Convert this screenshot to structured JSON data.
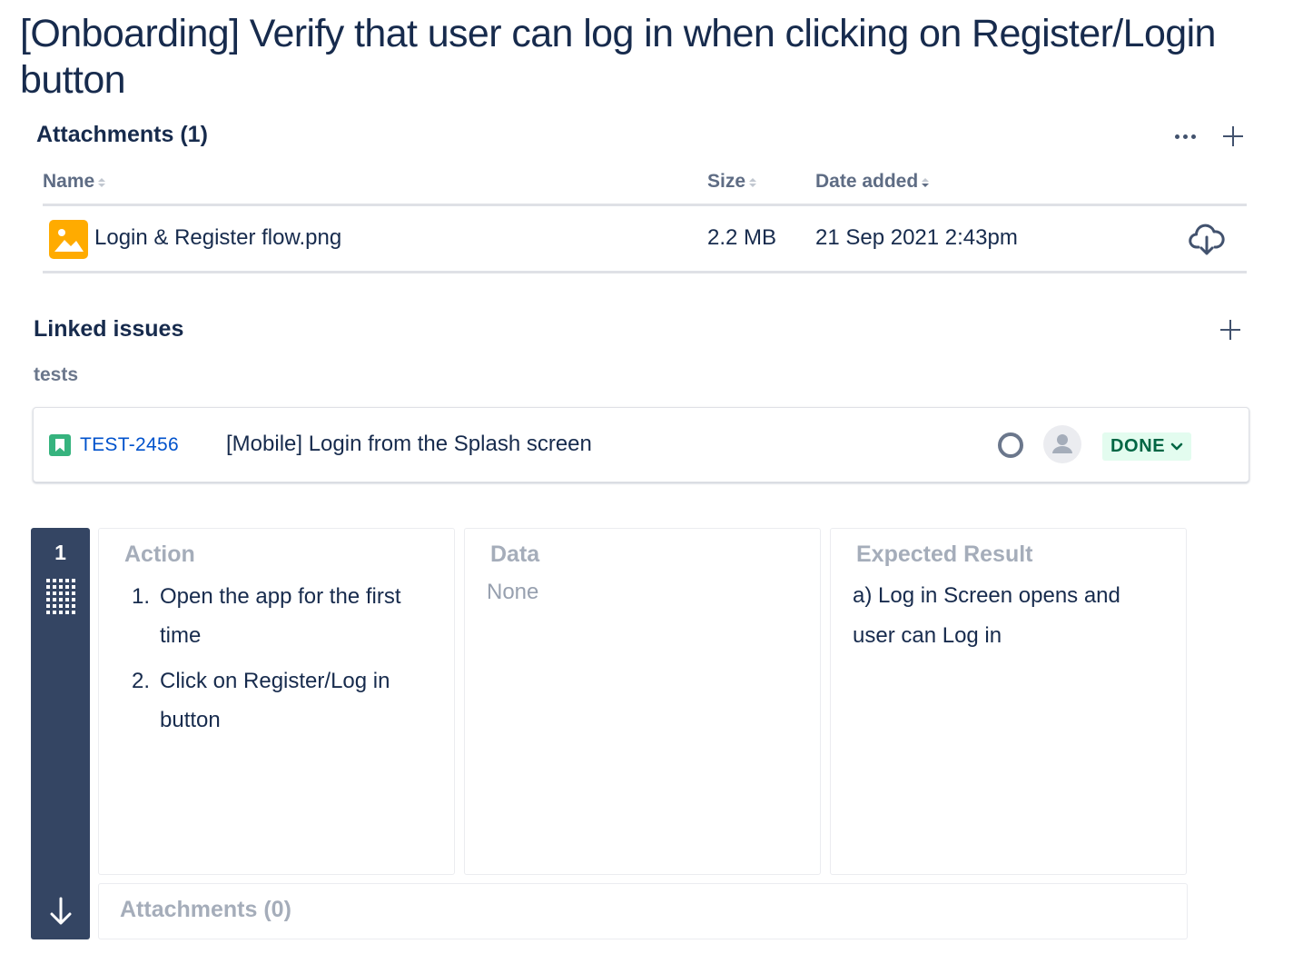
{
  "issue": {
    "title": "[Onboarding] Verify that user can log in when clicking on Register/Login button"
  },
  "attachments": {
    "header": "Attachments (1)",
    "columns": {
      "name": "Name",
      "size": "Size",
      "date": "Date added"
    },
    "files": [
      {
        "name": "Login & Register flow.png",
        "size": "2.2 MB",
        "date": "21 Sep 2021 2:43pm",
        "icon": "image-file-icon"
      }
    ],
    "actions": {
      "more": "more-actions-icon",
      "add": "add-icon",
      "download": "download-cloud-icon"
    }
  },
  "linked_issues": {
    "header": "Linked issues",
    "relation": "tests",
    "items": [
      {
        "key": "TEST-2456",
        "summary": "[Mobile] Login from the Splash screen",
        "type_icon": "story-icon",
        "status": "DONE",
        "status_color": "#006644",
        "status_bg": "#e3fcef"
      }
    ]
  },
  "test_step": {
    "number": "1",
    "action": {
      "title": "Action",
      "items": [
        {
          "num": "1.",
          "text": "Open the app for the first time"
        },
        {
          "num": "2.",
          "text": "Click on Register/Log in button"
        }
      ]
    },
    "data": {
      "title": "Data",
      "value": "None"
    },
    "expected": {
      "title": "Expected Result",
      "value": "a) Log in Screen opens and user can Log in"
    },
    "attachments_label": "Attachments (0)"
  },
  "colors": {
    "text_primary": "#172b4d",
    "text_muted": "#a5adba",
    "link": "#0052cc",
    "step_bar": "#344563",
    "image_icon": "#ffab00",
    "story_icon": "#36b37e"
  }
}
